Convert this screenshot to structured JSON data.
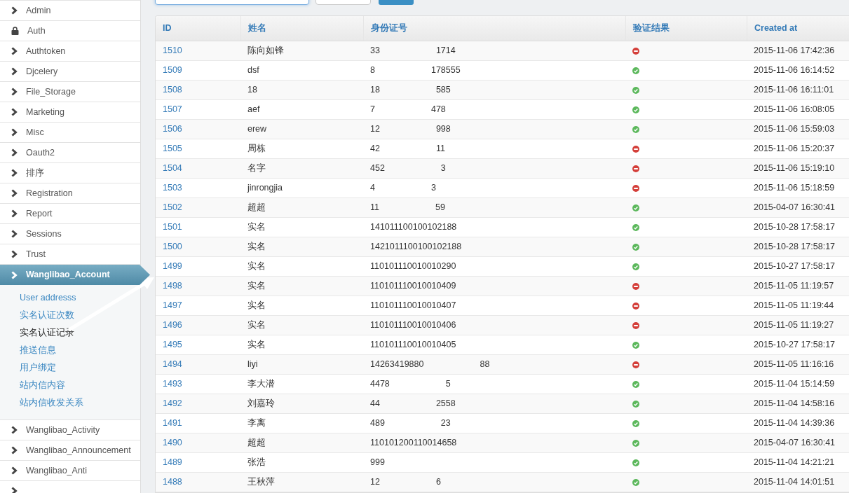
{
  "toolbar": {
    "buttons": [
      {
        "kind": "plain"
      },
      {
        "kind": "primary"
      }
    ]
  },
  "sidebar": {
    "items": [
      {
        "label": "Admin",
        "kind": "plain",
        "active": false
      },
      {
        "label": "Auth",
        "kind": "locked",
        "active": false
      },
      {
        "label": "Authtoken",
        "kind": "plain",
        "active": false
      },
      {
        "label": "Djcelery",
        "kind": "plain",
        "active": false
      },
      {
        "label": "File_Storage",
        "kind": "plain",
        "active": false
      },
      {
        "label": "Marketing",
        "kind": "plain",
        "active": false
      },
      {
        "label": "Misc",
        "kind": "plain",
        "active": false
      },
      {
        "label": "Oauth2",
        "kind": "plain",
        "active": false
      },
      {
        "label": "排序",
        "kind": "plain",
        "active": false
      },
      {
        "label": "Registration",
        "kind": "plain",
        "active": false
      },
      {
        "label": "Report",
        "kind": "plain",
        "active": false
      },
      {
        "label": "Sessions",
        "kind": "plain",
        "active": false
      },
      {
        "label": "Trust",
        "kind": "plain",
        "active": false
      },
      {
        "label": "Wanglibao_Account",
        "kind": "plain",
        "active": true,
        "children": [
          {
            "label": "User addresss",
            "selected": false
          },
          {
            "label": "实名认证次数",
            "selected": false
          },
          {
            "label": "实名认证记录",
            "selected": true
          },
          {
            "label": "推送信息",
            "selected": false
          },
          {
            "label": "用户绑定",
            "selected": false
          },
          {
            "label": "站内信内容",
            "selected": false
          },
          {
            "label": "站内信收发关系",
            "selected": false
          }
        ]
      },
      {
        "label": "Wanglibao_Activity",
        "kind": "plain",
        "active": false
      },
      {
        "label": "Wanglibao_Announcement",
        "kind": "plain",
        "active": false
      },
      {
        "label": "Wanglibao_Anti",
        "kind": "plain",
        "active": false
      },
      {
        "kind": "plain",
        "active": false
      }
    ]
  },
  "table": {
    "columns": [
      "ID",
      "姓名",
      "身份证号",
      "验证结果",
      "Created at"
    ],
    "rows": [
      {
        "id": "1510",
        "name": "陈向如锋",
        "id_number": [
          "33",
          "1714"
        ],
        "verified": false,
        "created_at": "2015-11-06 17:42:36"
      },
      {
        "id": "1509",
        "name": "dsf",
        "id_number": [
          "8",
          "178555"
        ],
        "verified": true,
        "created_at": "2015-11-06 16:14:52"
      },
      {
        "id": "1508",
        "name": "18",
        "id_number": [
          "18",
          "585"
        ],
        "verified": true,
        "created_at": "2015-11-06 16:11:01"
      },
      {
        "id": "1507",
        "name": "aef",
        "id_number": [
          "7",
          "478"
        ],
        "verified": true,
        "created_at": "2015-11-06 16:08:05"
      },
      {
        "id": "1506",
        "name": "erew",
        "id_number": [
          "12",
          "998"
        ],
        "verified": true,
        "created_at": "2015-11-06 15:59:03"
      },
      {
        "id": "1505",
        "name": "周栋",
        "id_number": [
          "42",
          "11"
        ],
        "verified": false,
        "created_at": "2015-11-06 15:20:37"
      },
      {
        "id": "1504",
        "name": "名字",
        "id_number": [
          "452",
          "3"
        ],
        "verified": false,
        "created_at": "2015-11-06 15:19:10"
      },
      {
        "id": "1503",
        "name": "jinrongjia",
        "id_number": [
          "4",
          "3"
        ],
        "verified": false,
        "created_at": "2015-11-06 15:18:59"
      },
      {
        "id": "1502",
        "name": "超超",
        "id_number": [
          "11",
          "59"
        ],
        "verified": true,
        "created_at": "2015-04-07 16:30:41"
      },
      {
        "id": "1501",
        "name": "实名",
        "id_number": [
          "141011100100102188"
        ],
        "verified": true,
        "created_at": "2015-10-28 17:58:17"
      },
      {
        "id": "1500",
        "name": "实名",
        "id_number": [
          "1421011100100102188"
        ],
        "verified": true,
        "created_at": "2015-10-28 17:58:17"
      },
      {
        "id": "1499",
        "name": "实名",
        "id_number": [
          "110101110010010290"
        ],
        "verified": true,
        "created_at": "2015-10-27 17:58:17"
      },
      {
        "id": "1498",
        "name": "实名",
        "id_number": [
          "110101110010010409"
        ],
        "verified": false,
        "created_at": "2015-11-05 11:19:57"
      },
      {
        "id": "1497",
        "name": "实名",
        "id_number": [
          "110101110010010407"
        ],
        "verified": false,
        "created_at": "2015-11-05 11:19:44"
      },
      {
        "id": "1496",
        "name": "实名",
        "id_number": [
          "110101110010010406"
        ],
        "verified": false,
        "created_at": "2015-11-05 11:19:27"
      },
      {
        "id": "1495",
        "name": "实名",
        "id_number": [
          "110101110010010405"
        ],
        "verified": true,
        "created_at": "2015-10-27 17:58:17"
      },
      {
        "id": "1494",
        "name": "liyi",
        "id_number": [
          "14263419880",
          "88"
        ],
        "verified": false,
        "created_at": "2015-11-05 11:16:16"
      },
      {
        "id": "1493",
        "name": "李大潜",
        "id_number": [
          "4478",
          "5"
        ],
        "verified": true,
        "created_at": "2015-11-04 15:14:59"
      },
      {
        "id": "1492",
        "name": "刘嘉玲",
        "id_number": [
          "44",
          "2558"
        ],
        "verified": true,
        "created_at": "2015-11-04 14:58:16"
      },
      {
        "id": "1491",
        "name": "李离",
        "id_number": [
          "489",
          "23"
        ],
        "verified": true,
        "created_at": "2015-11-04 14:39:36"
      },
      {
        "id": "1490",
        "name": "超超",
        "id_number": [
          "110101200110014658"
        ],
        "verified": true,
        "created_at": "2015-04-07 16:30:41"
      },
      {
        "id": "1489",
        "name": "张浩",
        "id_number": [
          "999"
        ],
        "verified": true,
        "created_at": "2015-11-04 14:21:21"
      },
      {
        "id": "1488",
        "name": "王秋萍",
        "id_number": [
          "12",
          "6"
        ],
        "verified": true,
        "created_at": "2015-11-04 14:01:51"
      }
    ]
  }
}
